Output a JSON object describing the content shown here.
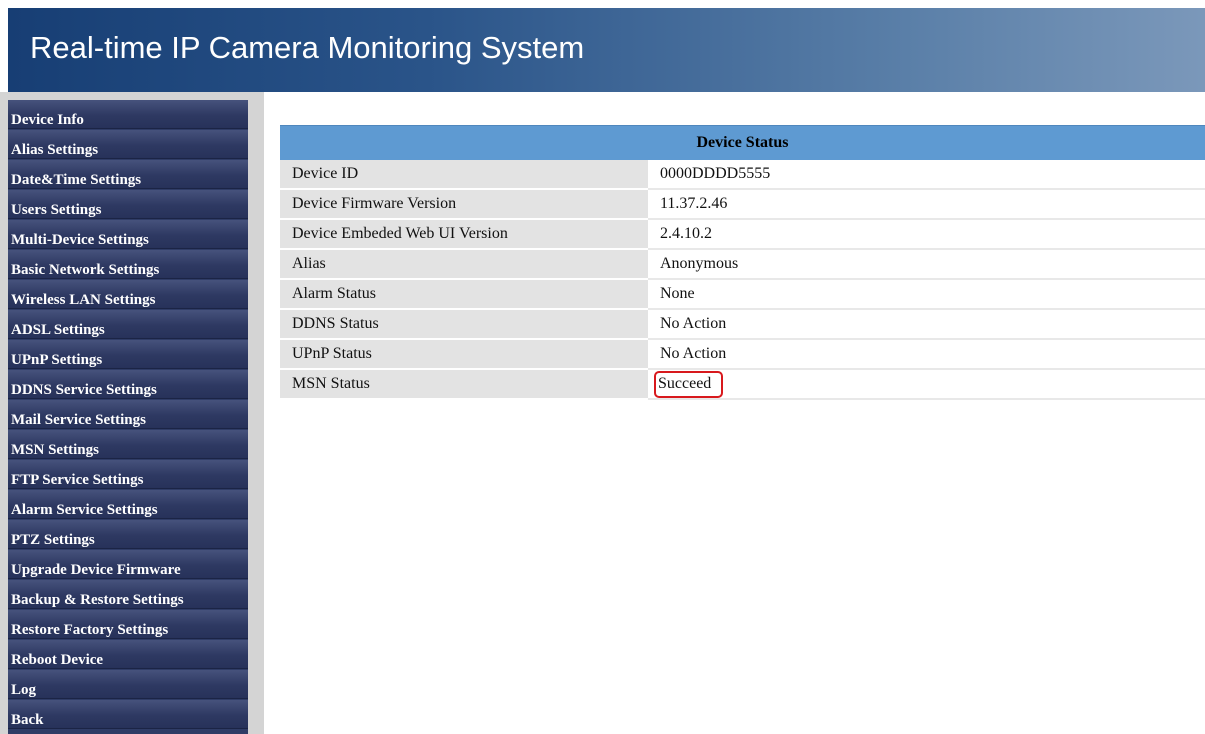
{
  "header": {
    "title": "Real-time IP Camera Monitoring System"
  },
  "sidebar": {
    "items": [
      {
        "label": "Device Info"
      },
      {
        "label": "Alias Settings"
      },
      {
        "label": "Date&Time Settings"
      },
      {
        "label": "Users Settings"
      },
      {
        "label": "Multi-Device Settings"
      },
      {
        "label": "Basic Network Settings"
      },
      {
        "label": "Wireless LAN Settings"
      },
      {
        "label": "ADSL Settings"
      },
      {
        "label": "UPnP Settings"
      },
      {
        "label": "DDNS Service Settings"
      },
      {
        "label": "Mail Service Settings"
      },
      {
        "label": "MSN Settings"
      },
      {
        "label": "FTP Service Settings"
      },
      {
        "label": "Alarm Service Settings"
      },
      {
        "label": "PTZ Settings"
      },
      {
        "label": "Upgrade Device Firmware"
      },
      {
        "label": "Backup & Restore Settings"
      },
      {
        "label": "Restore Factory Settings"
      },
      {
        "label": "Reboot Device"
      },
      {
        "label": "Log"
      },
      {
        "label": "Back"
      }
    ]
  },
  "status": {
    "title": "Device Status",
    "rows": [
      {
        "label": "Device ID",
        "value": "0000DDDD5555"
      },
      {
        "label": "Device Firmware Version",
        "value": "11.37.2.46"
      },
      {
        "label": "Device Embeded Web UI Version",
        "value": "2.4.10.2"
      },
      {
        "label": "Alias",
        "value": "Anonymous"
      },
      {
        "label": "Alarm Status",
        "value": "None"
      },
      {
        "label": "DDNS Status",
        "value": "No Action"
      },
      {
        "label": "UPnP Status",
        "value": "No Action"
      },
      {
        "label": "MSN Status",
        "value": "Succeed"
      }
    ]
  },
  "colors": {
    "header_gradient_start": "#173e74",
    "header_gradient_end": "#7b98ba",
    "sidebar_item": "#2e3962",
    "table_header": "#5e9ad2",
    "label_cell": "#e3e3e3",
    "highlight_border": "#d8191d"
  }
}
